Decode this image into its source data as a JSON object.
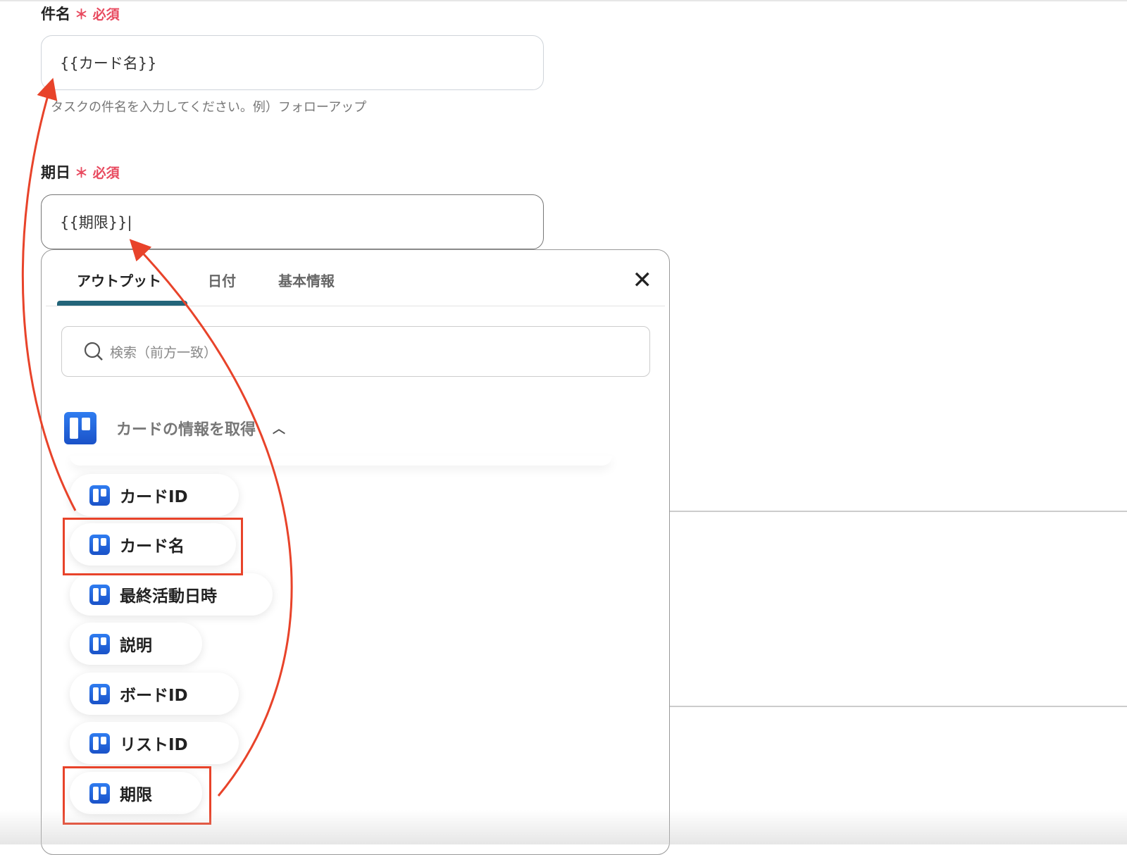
{
  "fields": [
    {
      "label": "件名",
      "required": "＊ 必須",
      "value": "{{カード名}}",
      "hint": "タスクの件名を入力してください。例）フォローアップ"
    },
    {
      "label": "期日",
      "required": "＊ 必須",
      "value": "{{期限}}|"
    }
  ],
  "panel": {
    "tabs": [
      {
        "label": "アウトプット",
        "selected": true
      },
      {
        "label": "日付"
      },
      {
        "label": "基本情報"
      }
    ],
    "close_icon": "close-icon",
    "search_placeholder": "検索（前方一致）",
    "group": {
      "title": "カードの情報を取得",
      "icon": "trello-icon",
      "expanded": true
    },
    "items": [
      "カードID",
      "カード名",
      "最終活動日時",
      "説明",
      "ボードID",
      "リストID",
      "期限"
    ],
    "highlighted": [
      "カード名",
      "期限"
    ]
  },
  "colors": {
    "required": "#e84a5f",
    "tab_indicator": "#23657a",
    "annotation": "#e8432a",
    "trello": "#1a52c8"
  }
}
